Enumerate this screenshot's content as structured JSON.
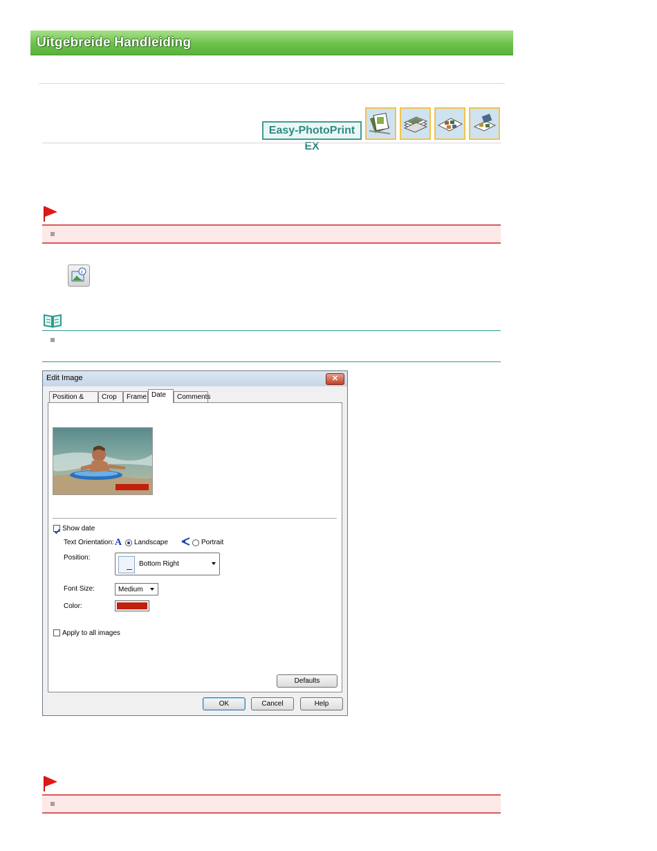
{
  "header": {
    "title": "Uitgebreide Handleiding"
  },
  "product": {
    "name": "Easy-PhotoPrint EX"
  },
  "thumbnails": [
    "album-icon",
    "photo-print-icon",
    "layout-print-icon",
    "stickers-icon"
  ],
  "dialog": {
    "title": "Edit Image",
    "close_label": "✕",
    "tabs": [
      {
        "label": "Position & Size",
        "active": false
      },
      {
        "label": "Crop",
        "active": false
      },
      {
        "label": "Frame",
        "active": false
      },
      {
        "label": "Date",
        "active": true
      },
      {
        "label": "Comments",
        "active": false
      }
    ],
    "show_date": {
      "label": "Show date",
      "checked": true
    },
    "text_orientation": {
      "label": "Text Orientation:",
      "options": [
        {
          "label": "Landscape",
          "selected": true
        },
        {
          "label": "Portrait",
          "selected": false
        }
      ]
    },
    "position": {
      "label": "Position:",
      "value": "Bottom Right"
    },
    "font_size": {
      "label": "Font Size:",
      "value": "Medium"
    },
    "color": {
      "label": "Color:",
      "value": "#c0200c"
    },
    "apply_all": {
      "label": "Apply to all images",
      "checked": false
    },
    "defaults_label": "Defaults",
    "ok_label": "OK",
    "cancel_label": "Cancel",
    "help_label": "Help"
  },
  "colors": {
    "banner": "#6cc24a",
    "important": "#d85a5a",
    "note": "#2f9a8e",
    "date_color": "#c0200c"
  }
}
